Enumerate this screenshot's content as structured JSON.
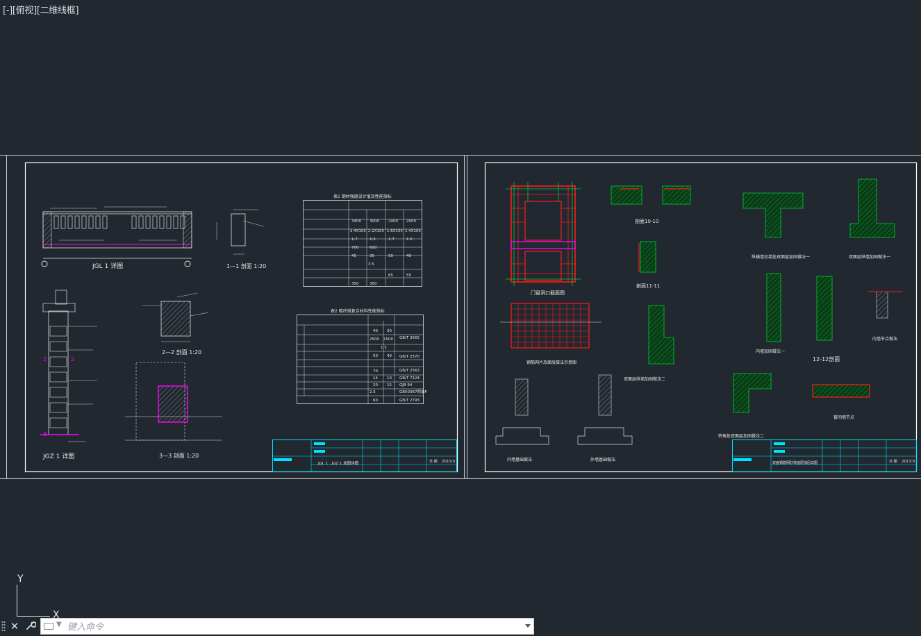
{
  "viewport": {
    "label": "[-][俯视][二维线框]"
  },
  "ucs": {
    "y_label": "Y",
    "x_label": "X"
  },
  "command_line": {
    "placeholder": "键入命令",
    "close_icon": "close-icon",
    "customize_icon": "wrench-icon"
  },
  "sheets": [
    {
      "name": "sheet-1",
      "details": [
        {
          "title": "JGL 1 详图"
        },
        {
          "title": "1-1 剖面",
          "scale": "1:20"
        },
        {
          "title": "JGZ 1 详图"
        },
        {
          "title": "2-2 剖面",
          "scale": "1:20"
        },
        {
          "title": "3-3 剖面",
          "scale": "1:20"
        }
      ],
      "tables": [
        {
          "title": "表1 钢材强度设计值及性能指标"
        },
        {
          "title": "表2 碳纤维复合材料性能指标"
        }
      ],
      "title_block": {
        "drawing_name": "JGL 1 . JGZ 1 加固详图",
        "date_label": "日 期",
        "date": "2013-5"
      }
    },
    {
      "name": "sheet-2",
      "details": [
        {
          "title": "门窗洞口截面图"
        },
        {
          "title": "剖面10-10"
        },
        {
          "title": "剖面11-11"
        },
        {
          "title": "钢筋网片及面层做法示意图"
        },
        {
          "title": "12-12剖面"
        },
        {
          "title": "内墙加固做法"
        },
        {
          "title": "外墙加固做法"
        },
        {
          "title": "窗间墙节点"
        },
        {
          "title": "转角处双面层加固做法二"
        }
      ],
      "title_block": {
        "drawing_name": "双面钢筋网砂浆面层加固详图",
        "date_label": "日 期",
        "date": "2013-5"
      }
    }
  ],
  "colors": {
    "background": "#212830",
    "frame": "#ffffff",
    "table_cyan": "#00e5ff",
    "rebar_red": "#ff1a1a",
    "mesh_green": "#00cc33",
    "magenta": "#ff00ff",
    "yellow": "#ffff00"
  }
}
